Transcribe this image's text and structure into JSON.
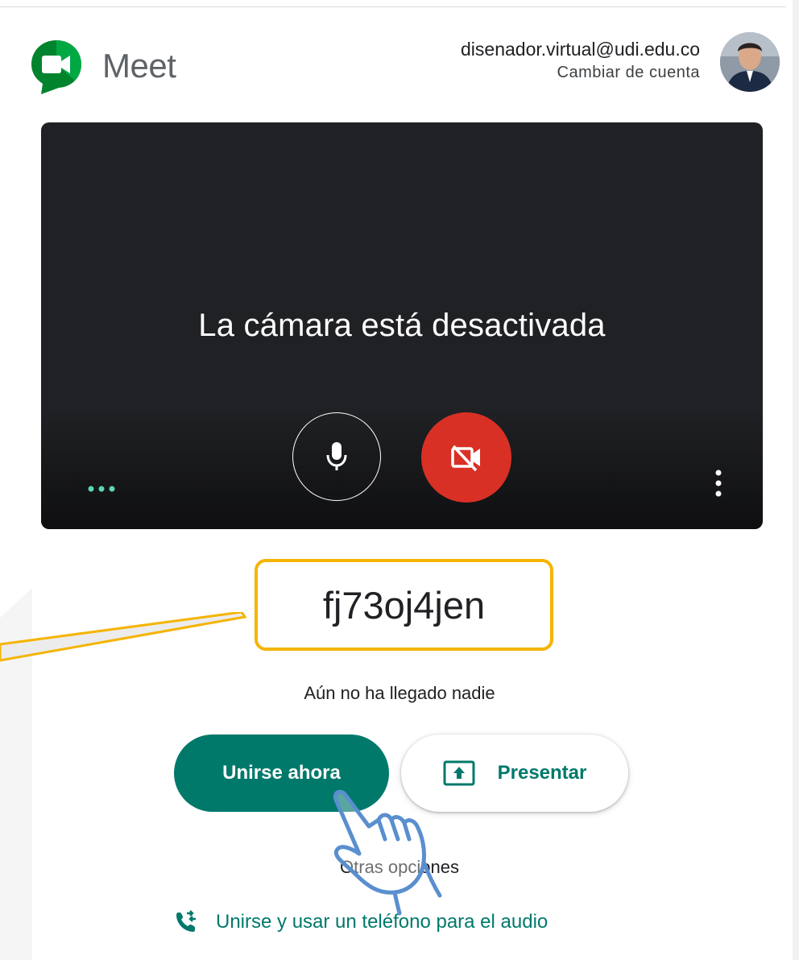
{
  "app": {
    "name": "Meet"
  },
  "account": {
    "email": "disenador.virtual@udi.edu.co",
    "switch_label": "Cambiar de cuenta"
  },
  "preview": {
    "camera_message": "La cámara está desactivada"
  },
  "meeting": {
    "code": "fj73oj4jen",
    "status": "Aún no ha llegado nadie"
  },
  "actions": {
    "join_label": "Unirse ahora",
    "present_label": "Presentar",
    "other_options_label": "Otras opciones",
    "phone_audio_label": "Unirse y usar un teléfono para el audio"
  },
  "colors": {
    "accent": "#00796b",
    "cam_off": "#d93025",
    "highlight": "#f5b400",
    "video_bg": "#202124"
  },
  "icons": [
    "meet-logo-icon",
    "microphone-icon",
    "camera-off-icon",
    "more-options-icon",
    "present-screen-icon",
    "phone-transfer-icon",
    "pointing-hand-icon"
  ]
}
